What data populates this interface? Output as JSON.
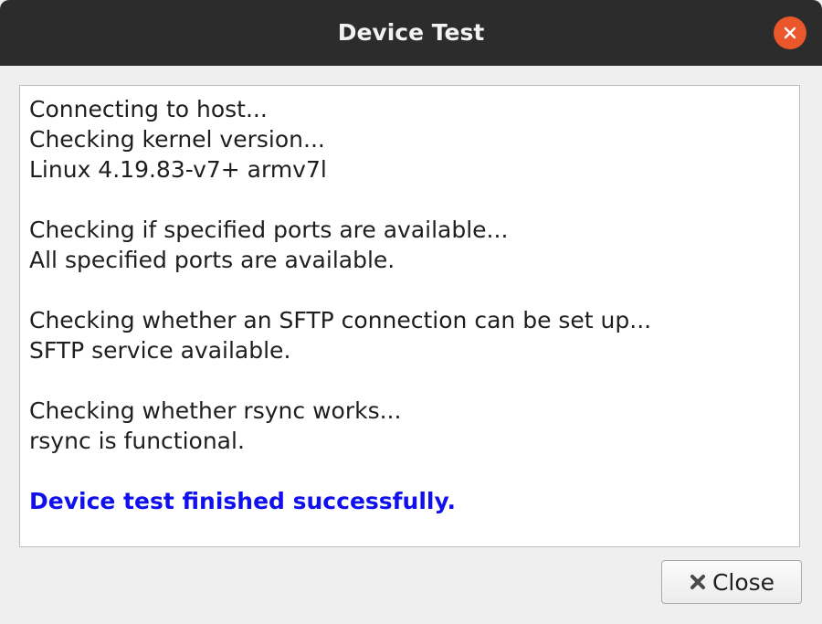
{
  "window": {
    "title": "Device Test"
  },
  "log": {
    "lines": [
      "Connecting to host...",
      "Checking kernel version...",
      "Linux 4.19.83-v7+ armv7l",
      "",
      "Checking if specified ports are available...",
      "All specified ports are available.",
      "",
      "Checking whether an SFTP connection can be set up...",
      "SFTP service available.",
      "",
      "Checking whether rsync works...",
      "rsync is functional.",
      ""
    ],
    "success_message": "Device test finished successfully."
  },
  "footer": {
    "close_label": "Close"
  },
  "colors": {
    "titlebar": "#2c2c2c",
    "close_button_accent": "#e9572a",
    "success_text": "#1010ee"
  },
  "icons": {
    "titlebar_close": "close-icon",
    "button_close": "x-icon"
  }
}
